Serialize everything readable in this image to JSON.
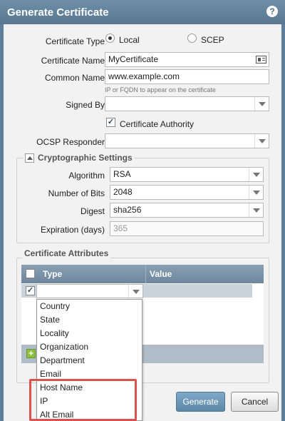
{
  "dialog": {
    "title": "Generate Certificate",
    "help_icon": "?"
  },
  "form": {
    "certificate_type_label": "Certificate Type",
    "type_local": "Local",
    "type_scep": "SCEP",
    "certificate_name_label": "Certificate Name",
    "certificate_name_value": "MyCertificate",
    "common_name_label": "Common Name",
    "common_name_value": "www.example.com",
    "common_name_hint": "IP or FQDN to appear on the certificate",
    "signed_by_label": "Signed By",
    "signed_by_value": "",
    "ca_checkbox_label": "Certificate Authority",
    "ocsp_label": "OCSP Responder",
    "ocsp_value": ""
  },
  "crypto": {
    "title": "Cryptographic Settings",
    "algorithm_label": "Algorithm",
    "algorithm_value": "RSA",
    "bits_label": "Number of Bits",
    "bits_value": "2048",
    "digest_label": "Digest",
    "digest_value": "sha256",
    "expiration_label": "Expiration (days)",
    "expiration_value": "365"
  },
  "attributes": {
    "title": "Certificate Attributes",
    "col_type": "Type",
    "col_value": "Value",
    "dropdown_options": [
      "Country",
      "State",
      "Locality",
      "Organization",
      "Department",
      "Email",
      "Host Name",
      "IP",
      "Alt Email"
    ]
  },
  "buttons": {
    "generate": "Generate",
    "cancel": "Cancel"
  }
}
